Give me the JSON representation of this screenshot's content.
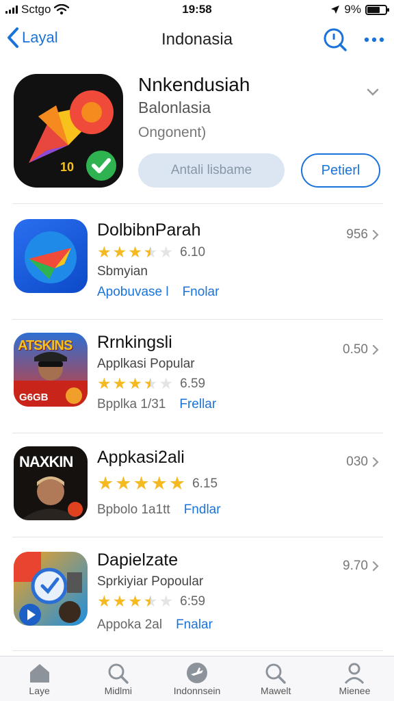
{
  "status_bar": {
    "carrier": "Sctgo",
    "time": "19:58",
    "battery": "9%"
  },
  "nav": {
    "back_label": "Layal",
    "title": "Indonasia"
  },
  "hero": {
    "name": "Nnkendusiah",
    "subtitle": "Balonlasia",
    "developer": "Ongonent)",
    "icon_badge": "10",
    "secondary_button": "Antali lisbame",
    "primary_button": "Petierl"
  },
  "apps": [
    {
      "name": "DolbibnParah",
      "line2": "",
      "rating": 3.5,
      "rating_text": "6.10",
      "subtitle": "Sbmyian",
      "category": "Apobuvase l",
      "action": "Fnolar",
      "price": "956",
      "icon": "arrow-logo-icon"
    },
    {
      "name": "Rrnkingsli",
      "line2": "Applkasi Popular",
      "rating": 3.5,
      "rating_text": "6.59",
      "subtitle": "",
      "category": "",
      "meta_gray": "Bpplka 1/31",
      "action": "Frellar",
      "price": "0.50",
      "icon_text": "ATSKINS",
      "icon_caption": "G6GB"
    },
    {
      "name": "Appkasi2ali",
      "line2": "",
      "rating": 5,
      "rating_text": "6.15",
      "subtitle": "",
      "meta_gray": "Bpbolo 1a1tt",
      "action": "Fndlar",
      "price": "030",
      "icon_text": "NAXKIN"
    },
    {
      "name": "Dapielzate",
      "line2": "Sprkiyiar Popoular",
      "rating": 3.5,
      "rating_text": "6:59",
      "subtitle": "",
      "meta_gray": "Appoka 2al",
      "action": "Fnalar",
      "price": "9.70",
      "icon": "games-collage-icon"
    }
  ],
  "tabs": [
    {
      "label": "Laye",
      "icon": "home-icon"
    },
    {
      "label": "Midlmi",
      "icon": "search-icon"
    },
    {
      "label": "Indonnsein",
      "icon": "plane-icon"
    },
    {
      "label": "Mawelt",
      "icon": "search-icon"
    },
    {
      "label": "Mienee",
      "icon": "person-icon"
    }
  ],
  "colors": {
    "accent": "#1a73d9",
    "star": "#f5b921"
  }
}
